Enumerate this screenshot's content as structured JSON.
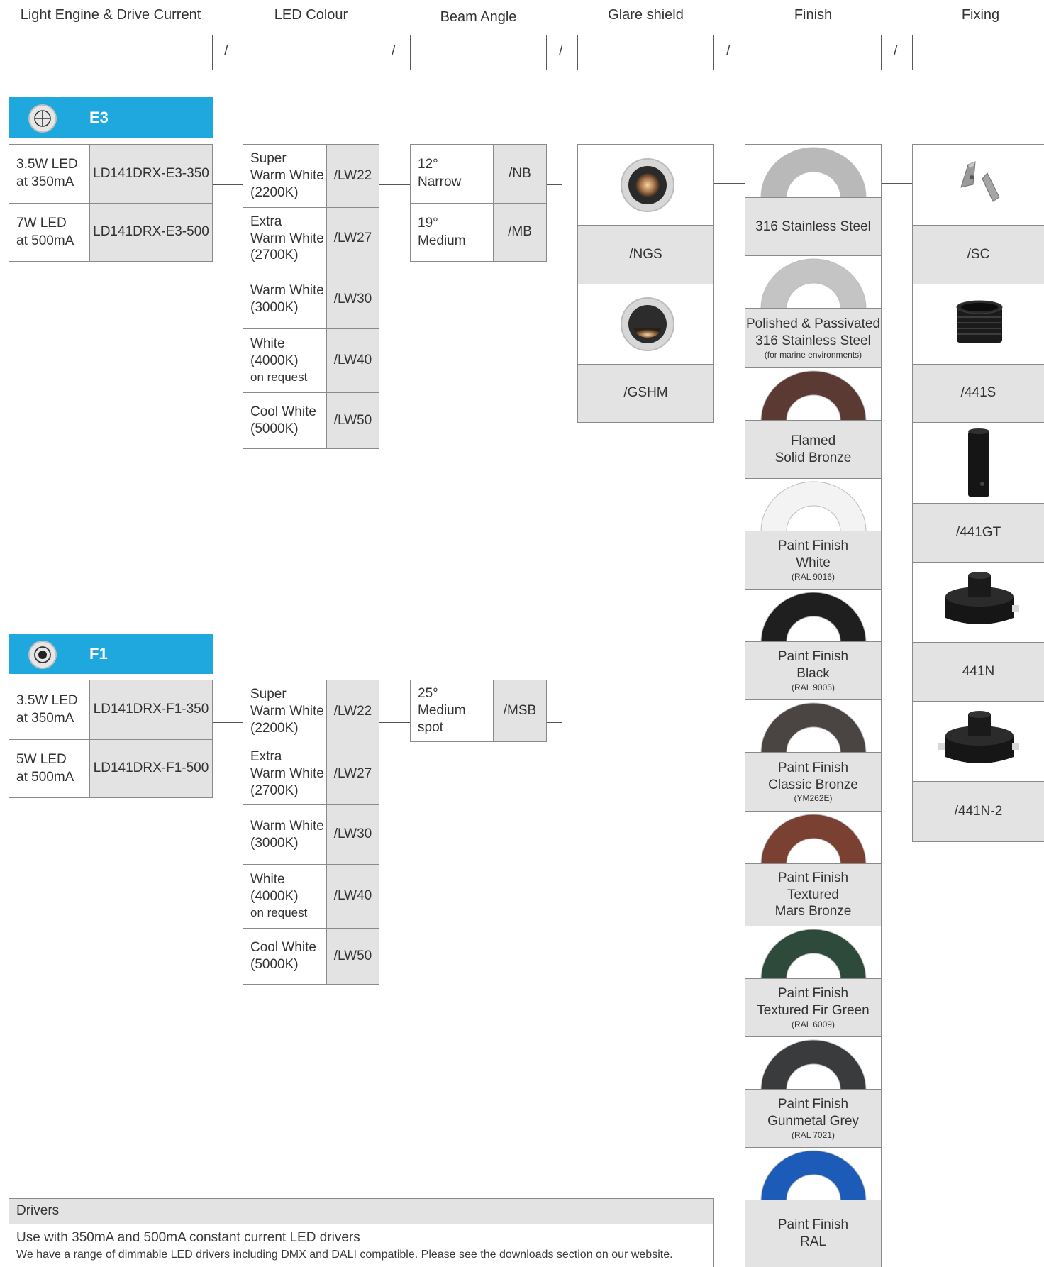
{
  "headers": [
    "Light Engine & Drive Current",
    "LED Colour",
    "Beam Angle",
    "Glare shield",
    "Finish",
    "Fixing"
  ],
  "separator": "/",
  "sections": [
    {
      "badge": "E3",
      "icon": "crosshair-icon",
      "engines": [
        {
          "desc": [
            "3.5W LED",
            "at 350mA"
          ],
          "code": "LD141DRX-E3-350"
        },
        {
          "desc": [
            "7W LED",
            "at 500mA"
          ],
          "code": "LD141DRX-E3-500"
        }
      ],
      "beams": [
        {
          "desc": [
            "12°",
            "Narrow"
          ],
          "code": "/NB"
        },
        {
          "desc": [
            "19°",
            "Medium"
          ],
          "code": "/MB"
        }
      ]
    },
    {
      "badge": "F1",
      "icon": "target-icon",
      "engines": [
        {
          "desc": [
            "3.5W LED",
            "at 350mA"
          ],
          "code": "LD141DRX-F1-350"
        },
        {
          "desc": [
            "5W LED",
            "at 500mA"
          ],
          "code": "LD141DRX-F1-500"
        }
      ],
      "beams": [
        {
          "desc": [
            "25°",
            "Medium",
            "spot"
          ],
          "code": "/MSB"
        }
      ]
    }
  ],
  "colours": [
    {
      "desc": [
        "Super",
        "Warm White",
        "(2200K)"
      ],
      "code": "/LW22"
    },
    {
      "desc": [
        "Extra",
        "Warm White",
        "(2700K)"
      ],
      "code": "/LW27"
    },
    {
      "desc": [
        "Warm White",
        "(3000K)"
      ],
      "code": "/LW30"
    },
    {
      "desc": [
        "White",
        "(4000K)",
        "on request"
      ],
      "code": "/LW40"
    },
    {
      "desc": [
        "Cool White",
        "(5000K)"
      ],
      "code": "/LW50"
    }
  ],
  "glare": [
    {
      "code": "/NGS",
      "image": "glare-none-icon"
    },
    {
      "code": "/GSHM",
      "image": "glare-hood-icon"
    }
  ],
  "finishes": [
    {
      "lines": [
        "316 Stainless Steel"
      ],
      "note": "",
      "color": "#b9b9b9"
    },
    {
      "lines": [
        "Polished & Passivated",
        "316 Stainless Steel"
      ],
      "note": "(for marine environments)",
      "color": "#c4c4c4"
    },
    {
      "lines": [
        "Flamed",
        "Solid Bronze"
      ],
      "note": "",
      "color": "#5b3a33"
    },
    {
      "lines": [
        "Paint Finish",
        "White"
      ],
      "note": "(RAL 9016)",
      "color": "#f3f3f3"
    },
    {
      "lines": [
        "Paint Finish",
        "Black"
      ],
      "note": "(RAL 9005)",
      "color": "#1f1f1f"
    },
    {
      "lines": [
        "Paint Finish",
        "Classic Bronze"
      ],
      "note": "(YM262E)",
      "color": "#4a4442"
    },
    {
      "lines": [
        "Paint Finish",
        "Textured",
        "Mars Bronze"
      ],
      "note": "",
      "color": "#7a4032"
    },
    {
      "lines": [
        "Paint Finish",
        "Textured Fir Green"
      ],
      "note": "(RAL 6009)",
      "color": "#2d4a3a"
    },
    {
      "lines": [
        "Paint Finish",
        "Gunmetal Grey"
      ],
      "note": "(RAL 7021)",
      "color": "#3a3b3d"
    },
    {
      "lines": [
        "Paint Finish",
        "RAL"
      ],
      "note": "",
      "color": "#1d5bb8"
    }
  ],
  "fixings": [
    {
      "code": "/SC",
      "image": "spring-clip-icon"
    },
    {
      "code": "/441S",
      "image": "sleeve-icon"
    },
    {
      "code": "/441GT",
      "image": "ground-tube-icon"
    },
    {
      "code": "441N",
      "image": "junction-box-icon"
    },
    {
      "code": "/441N-2",
      "image": "junction-box-2-icon"
    }
  ],
  "drivers": {
    "title": "Drivers",
    "line1": "Use with 350mA and 500mA constant current LED drivers",
    "line2": "We have a range of dimmable LED drivers including DMX and DALI compatible. Please see the downloads section on our website."
  }
}
